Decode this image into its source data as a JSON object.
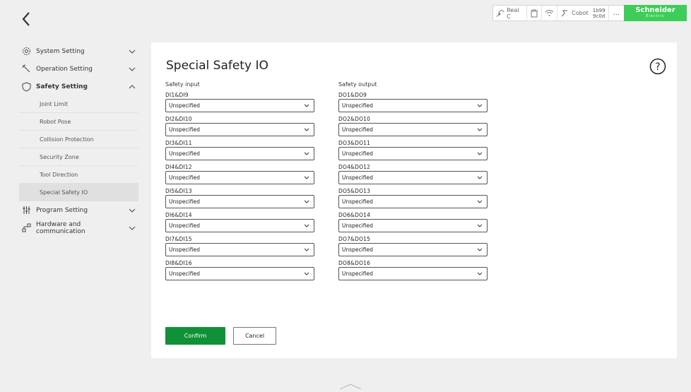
{
  "status": {
    "mode_label": "Real C",
    "robot_label": "Cobot",
    "robot_id_line1": "1b99",
    "robot_id_line2": "9c0d",
    "more_label": "...",
    "brand_line1": "Schneider",
    "brand_line2": "Electric"
  },
  "sidebar": {
    "items": [
      {
        "label": "System Setting",
        "icon": "gear-icon",
        "expanded": false
      },
      {
        "label": "Operation Setting",
        "icon": "wrench-icon",
        "expanded": false
      },
      {
        "label": "Safety Setting",
        "icon": "shield-icon",
        "expanded": true
      },
      {
        "label": "Program Setting",
        "icon": "sliders-icon",
        "expanded": false
      },
      {
        "label": "Hardware and communication",
        "icon": "network-icon",
        "expanded": false
      }
    ],
    "safety_sub": [
      "Joint Limit",
      "Robot Pose",
      "Collision Protection",
      "Security Zone",
      "Tool Direction",
      "Special Safety IO"
    ]
  },
  "main": {
    "title": "Special Safety IO",
    "input_header": "Safety input",
    "output_header": "Safety output",
    "inputs": [
      {
        "label": "DI1&DI9",
        "value": "Unspecified"
      },
      {
        "label": "DI2&DI10",
        "value": "Unspecified"
      },
      {
        "label": "DI3&DI11",
        "value": "Unspecified"
      },
      {
        "label": "DI4&DI12",
        "value": "Unspecified"
      },
      {
        "label": "DI5&DI13",
        "value": "Unspecified"
      },
      {
        "label": "DI6&DI14",
        "value": "Unspecified"
      },
      {
        "label": "DI7&DI15",
        "value": "Unspecified"
      },
      {
        "label": "DI8&DI16",
        "value": "Unspecified"
      }
    ],
    "outputs": [
      {
        "label": "DO1&DO9",
        "value": "Unspecified"
      },
      {
        "label": "DO2&DO10",
        "value": "Unspecified"
      },
      {
        "label": "DO3&DO11",
        "value": "Unspecified"
      },
      {
        "label": "DO4&DO12",
        "value": "Unspecified"
      },
      {
        "label": "DO5&DO13",
        "value": "Unspecified"
      },
      {
        "label": "DO6&DO14",
        "value": "Unspecified"
      },
      {
        "label": "DO7&DO15",
        "value": "Unspecified"
      },
      {
        "label": "DO8&DO16",
        "value": "Unspecified"
      }
    ],
    "confirm_label": "Confirm",
    "cancel_label": "Cancel",
    "help_label": "?"
  },
  "colors": {
    "accent": "#109138",
    "brand": "#3dcd58",
    "panel": "#ffffff",
    "background": "#efefef"
  }
}
